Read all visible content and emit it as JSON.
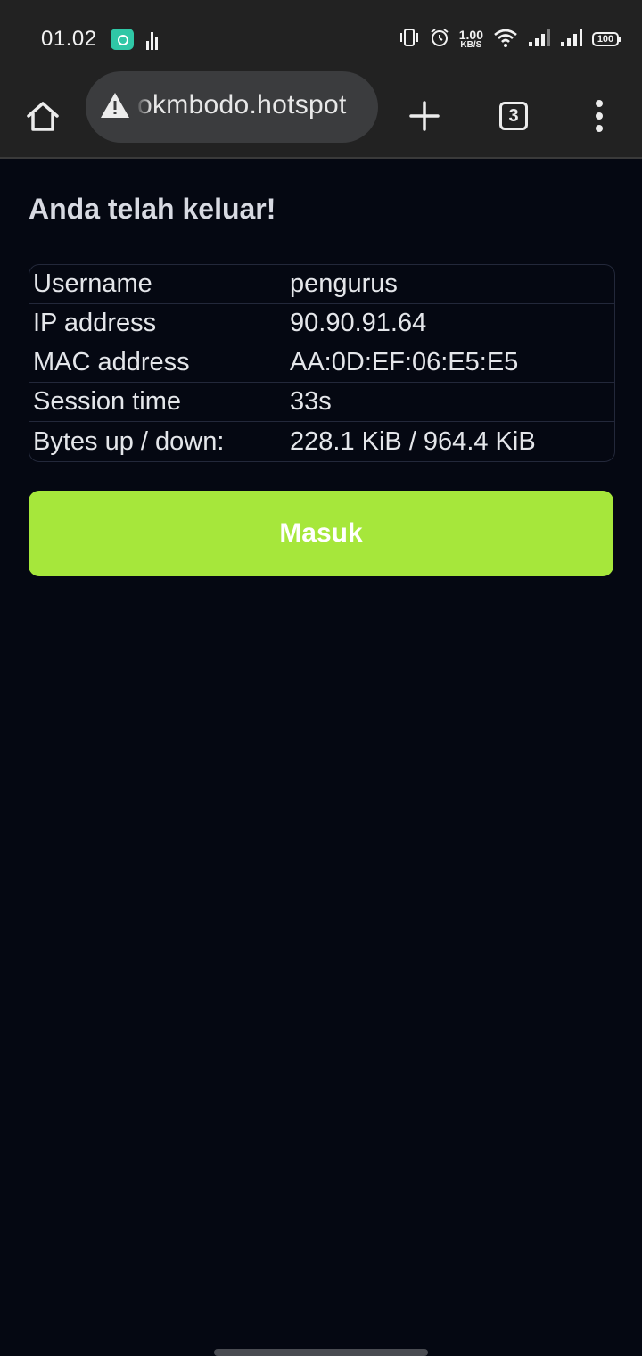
{
  "status_bar": {
    "time": "01.02",
    "net_speed_value": "1.00",
    "net_speed_unit": "KB/S",
    "battery": "100",
    "icons": [
      "app-notification-icon",
      "signal-bars-icon",
      "vibrate-icon",
      "alarm-icon",
      "wifi-icon",
      "cell-signal-icon",
      "cell-signal-icon",
      "battery-icon"
    ]
  },
  "browser": {
    "url": "okmbodo.hotspot",
    "tab_count": "3",
    "icons": [
      "home-icon",
      "warning-icon",
      "plus-icon",
      "tabs-icon",
      "more-vert-icon"
    ]
  },
  "page": {
    "title": "Anda telah keluar!",
    "info": [
      {
        "label": "Username",
        "value": "pengurus"
      },
      {
        "label": "IP address",
        "value": "90.90.91.64"
      },
      {
        "label": "MAC address",
        "value": "AA:0D:EF:06:E5:E5"
      },
      {
        "label": "Session time",
        "value": "33s"
      },
      {
        "label": "Bytes up / down:",
        "value": "228.1 KiB / 964.4 KiB"
      }
    ],
    "login_button_label": "Masuk"
  },
  "colors": {
    "background": "#050812",
    "toolbar": "#222222",
    "url_bar": "#3b3c3e",
    "button": "#a6e73b",
    "table_border": "#23283a"
  }
}
